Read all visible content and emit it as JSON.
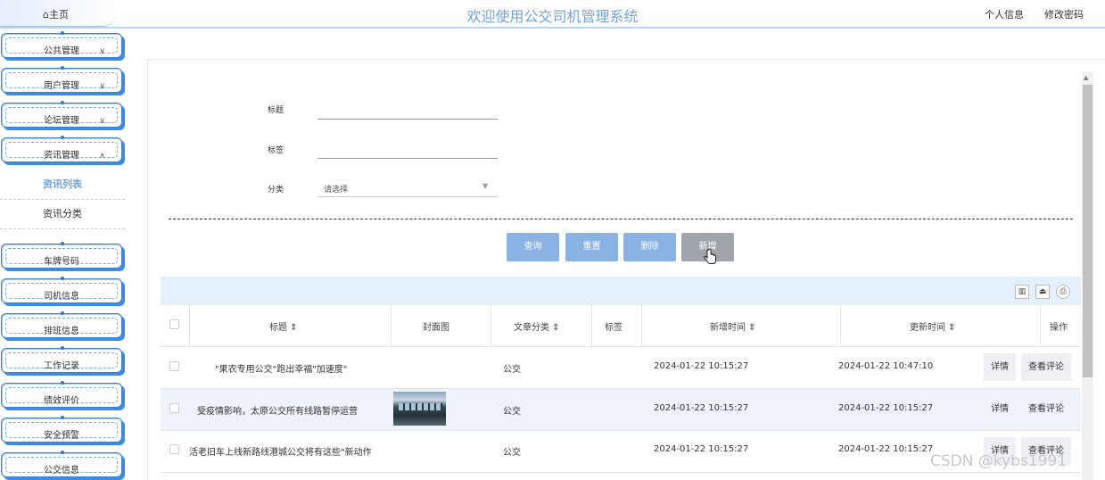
{
  "header": {
    "home": "⌂主页",
    "title": "欢迎使用公交司机管理系统",
    "profile": "个人信息",
    "change_password": "修改密码"
  },
  "sidebar": {
    "groups": [
      {
        "label": "公共管理",
        "chevron": "∨"
      },
      {
        "label": "用户管理",
        "chevron": "∨"
      },
      {
        "label": "论坛管理",
        "chevron": "∨"
      },
      {
        "label": "资讯管理",
        "chevron": "∧"
      }
    ],
    "subitems": [
      {
        "label": "资讯列表",
        "active": true
      },
      {
        "label": "资讯分类",
        "active": false
      }
    ],
    "items": [
      {
        "label": "车牌号码"
      },
      {
        "label": "司机信息"
      },
      {
        "label": "排班信息"
      },
      {
        "label": "工作记录"
      },
      {
        "label": "绩效评价"
      },
      {
        "label": "安全预警"
      },
      {
        "label": "公交信息"
      }
    ]
  },
  "form": {
    "title_label": "标题",
    "tag_label": "标签",
    "category_label": "分类",
    "category_placeholder": "请选择"
  },
  "buttons": {
    "query": "查询",
    "reset": "重置",
    "delete": "删除",
    "add": "新增"
  },
  "table": {
    "tools": [
      "▥",
      "⏏",
      "⎙"
    ],
    "columns": [
      "标题 ⇕",
      "封面图",
      "文章分类 ⇕",
      "标签",
      "新增时间 ⇕",
      "更新时间 ⇕",
      "操作"
    ],
    "rows": [
      {
        "title": "\"果农专用公交\"跑出幸福\"加速度\"",
        "category": "公交",
        "created": "2024-01-22 10:15:27",
        "updated": "2024-01-22 10:47:10",
        "detail": "详情",
        "comments": "查看评论"
      },
      {
        "title": "受疫情影响，太原公交所有线路暂停运营",
        "category": "公交",
        "created": "2024-01-22 10:15:27",
        "updated": "2024-01-22 10:15:27",
        "detail": "详情",
        "comments": "查看评论"
      },
      {
        "title": "活老旧车上线新路线港城公交将有这些\"新动作",
        "category": "公交",
        "created": "2024-01-22 10:15:27",
        "updated": "2024-01-22 10:15:27",
        "detail": "详情",
        "comments": "查看评论"
      }
    ]
  },
  "watermark": "CSDN @kybs1991",
  "colors": {
    "accent": "#6fa3de",
    "button": "#8ab3e4",
    "button_hover": "#9fa5ab",
    "menu_border": "#3a7fd4"
  }
}
